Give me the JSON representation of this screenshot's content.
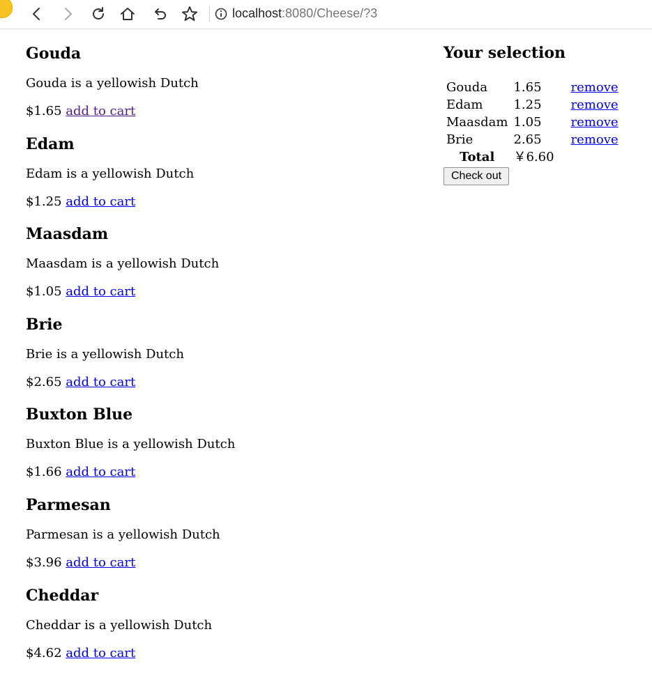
{
  "browser": {
    "url_host": "localhost",
    "url_path": ":8080/Cheese/?3"
  },
  "products": [
    {
      "name": "Gouda",
      "description": "Gouda is a yellowish Dutch",
      "price": "$1.65",
      "action": "add to cart"
    },
    {
      "name": "Edam",
      "description": "Edam is a yellowish Dutch",
      "price": "$1.25",
      "action": "add to cart"
    },
    {
      "name": "Maasdam",
      "description": "Maasdam is a yellowish Dutch",
      "price": "$1.05",
      "action": "add to cart"
    },
    {
      "name": "Brie",
      "description": "Brie is a yellowish Dutch",
      "price": "$2.65",
      "action": "add to cart"
    },
    {
      "name": "Buxton Blue",
      "description": "Buxton Blue is a yellowish Dutch",
      "price": "$1.66",
      "action": "add to cart"
    },
    {
      "name": "Parmesan",
      "description": "Parmesan is a yellowish Dutch",
      "price": "$3.96",
      "action": "add to cart"
    },
    {
      "name": "Cheddar",
      "description": "Cheddar is a yellowish Dutch",
      "price": "$4.62",
      "action": "add to cart"
    }
  ],
  "selection": {
    "title": "Your selection",
    "items": [
      {
        "name": "Gouda",
        "price": "1.65",
        "action": "remove"
      },
      {
        "name": "Edam",
        "price": "1.25",
        "action": "remove"
      },
      {
        "name": "Maasdam",
        "price": "1.05",
        "action": "remove"
      },
      {
        "name": "Brie",
        "price": "2.65",
        "action": "remove"
      }
    ],
    "total_label": "Total",
    "total_value": "￥6.60",
    "checkout_label": "Check out"
  }
}
